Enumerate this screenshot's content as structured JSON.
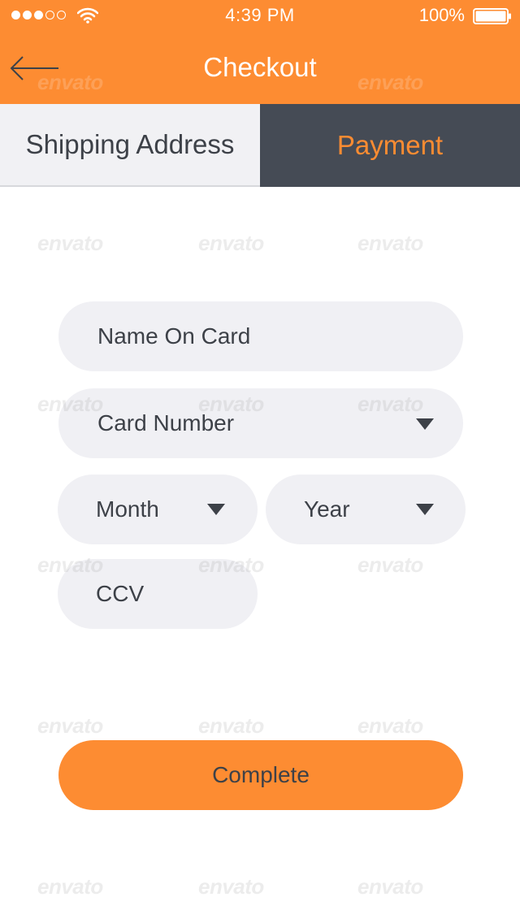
{
  "colors": {
    "accent": "#fd8c32",
    "tab_active_bg": "#454b55",
    "field_bg": "#f0f0f4",
    "text_dark": "#3d4148"
  },
  "status_bar": {
    "time": "4:39 PM",
    "battery_percent": "100%",
    "signal_bars_filled": 3,
    "signal_bars_total": 5,
    "battery_level": 1.0
  },
  "nav": {
    "title": "Checkout",
    "back_icon": "arrow-left-icon"
  },
  "tabs": [
    {
      "label": "Shipping Address",
      "active": false
    },
    {
      "label": "Payment",
      "active": true
    }
  ],
  "form": {
    "name_on_card": {
      "placeholder": "Name On Card"
    },
    "card_number": {
      "placeholder": "Card Number",
      "icon": "caret-down-icon"
    },
    "month": {
      "placeholder": "Month",
      "icon": "caret-down-icon"
    },
    "year": {
      "placeholder": "Year",
      "icon": "caret-down-icon"
    },
    "ccv": {
      "placeholder": "CCV"
    }
  },
  "actions": {
    "complete_label": "Complete"
  },
  "watermark": {
    "text": "envato"
  }
}
